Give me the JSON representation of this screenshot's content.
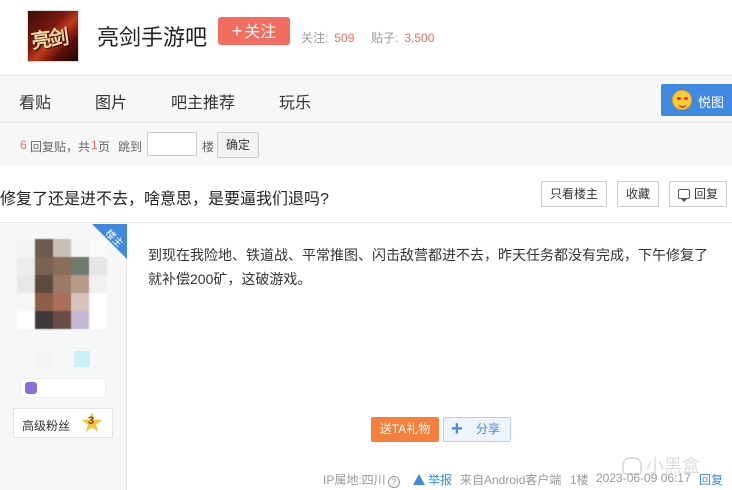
{
  "forum": {
    "logo_text": "亮剑",
    "name": "亮剑手游吧",
    "follow_label": "关注",
    "followers_label": "关注:",
    "followers": "509",
    "posts_label": "贴子:",
    "posts": "3,500"
  },
  "nav": {
    "items": [
      {
        "label": "看贴"
      },
      {
        "label": "图片"
      },
      {
        "label": "吧主推荐"
      },
      {
        "label": "玩乐"
      }
    ],
    "yuetu_label": "悦图"
  },
  "pager": {
    "reply_count": "6",
    "reply_text": "回复贴，共",
    "pages": "1",
    "pages_suffix": "页",
    "jump_label": "跳到",
    "floor_label": "楼",
    "jump_value": "",
    "confirm_label": "确定"
  },
  "thread": {
    "title": "修复了还是进不去，啥意思，是要逼我们退吗?",
    "only_op_label": "只看楼主",
    "favorite_label": "收藏",
    "reply_label": "回复"
  },
  "author": {
    "op_tag": "楼主",
    "fan_level_label": "高级粉丝",
    "fan_level": "3"
  },
  "post": {
    "content": "到现在我险地、铁道战、平常推图、闪击敌营都进不去，昨天任务都没有完成，下午修复了就补偿200矿，这破游戏。",
    "gift_label": "送TA礼物",
    "share_label": "分享",
    "ip_location": "IP属地:四川",
    "report_label": "举报",
    "source": "来自Android客户端",
    "floor": "1楼",
    "datetime": "2023-06-09 06:17",
    "reply_label": "回复"
  },
  "watermark": "小黑盒",
  "colors": {
    "accent_red": "#f36c60",
    "link_blue": "#3f8ae0",
    "gift_orange": "#f5803e",
    "nav_bg": "#f6f7f9"
  }
}
